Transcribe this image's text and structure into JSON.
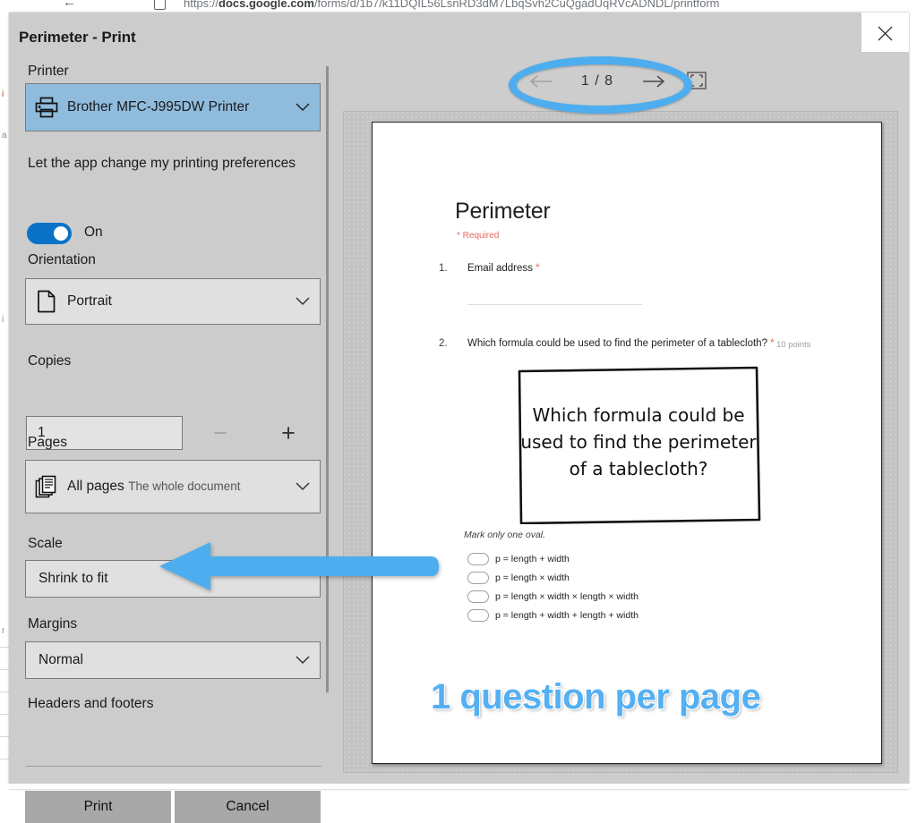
{
  "browser": {
    "url_bold": "docs.google.com",
    "url_rest": "/forms/d/1b7/k11DQIL56LsnRD3dM7LbqSvh2CuQgadUqRVcADNDL/printform",
    "url_prefix": "https://"
  },
  "dialog": {
    "title": "Perimeter - Print",
    "close_icon": "close-icon"
  },
  "settings": {
    "printer": {
      "label": "Printer",
      "value": "Brother MFC-J995DW Printer",
      "icon": "printer-icon",
      "chevron": "chevron-down-icon"
    },
    "app_preferences": {
      "label": "Let the app change my printing preferences",
      "state": "On"
    },
    "orientation": {
      "label": "Orientation",
      "value": "Portrait",
      "icon": "page-portrait-icon",
      "chevron": "chevron-down-icon"
    },
    "copies": {
      "label": "Copies",
      "value": "1",
      "minus": "−",
      "plus": "+"
    },
    "pages": {
      "label": "Pages",
      "value": "All pages",
      "sub": "The whole document",
      "icon": "pages-stack-icon",
      "chevron": "chevron-down-icon"
    },
    "scale": {
      "label": "Scale",
      "value": "Shrink to fit"
    },
    "margins": {
      "label": "Margins",
      "value": "Normal",
      "chevron": "chevron-down-icon"
    },
    "headers_footers": {
      "label": "Headers and footers"
    },
    "actions": {
      "print": "Print",
      "cancel": "Cancel"
    }
  },
  "preview": {
    "page_indicator": "1 / 8",
    "current_page": 1,
    "total_pages": 8,
    "prev_icon": "arrow-left-icon",
    "next_icon": "arrow-right-icon",
    "fullscreen_icon": "fullscreen-icon"
  },
  "document": {
    "title": "Perimeter",
    "required_note": "* Required",
    "questions": [
      {
        "number": "1.",
        "text": "Email address",
        "required": true,
        "points": ""
      },
      {
        "number": "2.",
        "text": "Which formula could be used to find the perimeter of a tablecloth?",
        "required": true,
        "points": "10 points"
      }
    ],
    "image_text_lines": [
      "Which formula could be",
      "used to find the perimeter",
      "of a tablecloth?"
    ],
    "mark_instruction": "Mark only one oval.",
    "options": [
      "p = length + width",
      "p = length × width",
      "p = length × width × length × width",
      "p = length + width + length + width"
    ]
  },
  "annotations": {
    "caption": "1 question per page",
    "accent_color": "#4dadef",
    "oval_target": "page-indicator",
    "arrow_target": "scale-combo"
  }
}
